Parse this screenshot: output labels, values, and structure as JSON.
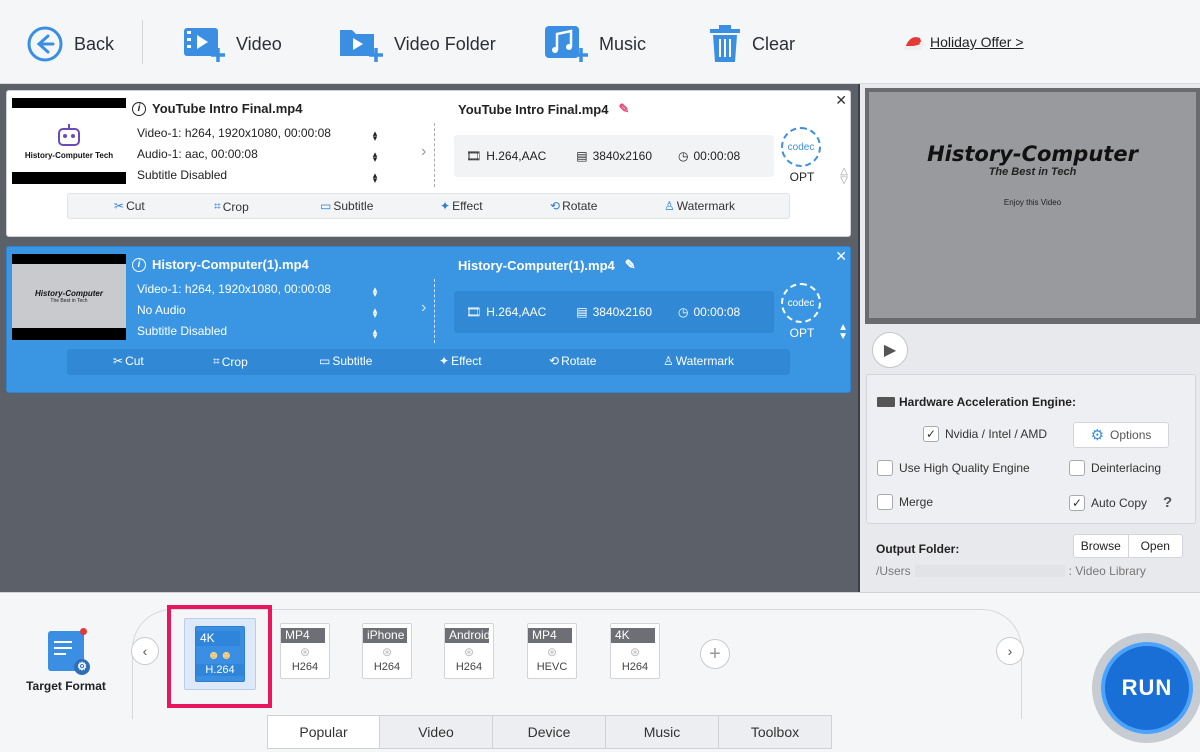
{
  "toolbar": {
    "back": "Back",
    "video": "Video",
    "video_folder": "Video Folder",
    "music": "Music",
    "clear": "Clear",
    "holiday": "Holiday Offer >"
  },
  "items": [
    {
      "thumb_title": "History-Computer Tech",
      "src_name": "YouTube Intro Final.mp4",
      "video_track": "Video-1: h264, 1920x1080, 00:00:08",
      "audio_track": "Audio-1: aac, 00:00:08",
      "subtitle": "Subtitle Disabled",
      "out_name": "YouTube Intro Final.mp4",
      "codec": "H.264,AAC",
      "resolution": "3840x2160",
      "duration": "00:00:08",
      "codec_label": "codec",
      "opt": "OPT"
    },
    {
      "thumb_title": "History-Computer",
      "thumb_sub": "The Best in Tech",
      "src_name": "History-Computer(1).mp4",
      "video_track": "Video-1: h264, 1920x1080, 00:00:08",
      "audio_track": "No Audio",
      "subtitle": "Subtitle Disabled",
      "out_name": "History-Computer(1).mp4",
      "codec": "H.264,AAC",
      "resolution": "3840x2160",
      "duration": "00:00:08",
      "codec_label": "codec",
      "opt": "OPT"
    }
  ],
  "edit": {
    "cut": "Cut",
    "crop": "Crop",
    "subtitle": "Subtitle",
    "effect": "Effect",
    "rotate": "Rotate",
    "watermark": "Watermark"
  },
  "preview": {
    "title": "History-Computer",
    "subtitle": "The Best in Tech",
    "small": "Enjoy this Video"
  },
  "hw": {
    "title": "Hardware Acceleration Engine:",
    "nvidia": "Nvidia / Intel / AMD",
    "options": "Options",
    "hq": "Use High Quality Engine",
    "deinterlacing": "Deinterlacing",
    "merge": "Merge",
    "autocopy": "Auto Copy",
    "help": "?"
  },
  "output": {
    "label": "Output Folder:",
    "browse": "Browse",
    "open": "Open",
    "path_start": "/Users",
    "path_end": ": Video Library"
  },
  "target_format": "Target Format",
  "formats": [
    {
      "top": "4K",
      "bottom": "H.264"
    },
    {
      "top": "MP4",
      "bottom": "H264"
    },
    {
      "top": "iPhone",
      "bottom": "H264"
    },
    {
      "top": "Android",
      "bottom": "H264"
    },
    {
      "top": "MP4",
      "bottom": "HEVC"
    },
    {
      "top": "4K",
      "bottom": "H264"
    }
  ],
  "tabs": [
    "Popular",
    "Video",
    "Device",
    "Music",
    "Toolbox"
  ],
  "run": "RUN",
  "colors": {
    "accent": "#3a96e3",
    "highlight": "#e8175d",
    "run": "#1a6fd6"
  }
}
